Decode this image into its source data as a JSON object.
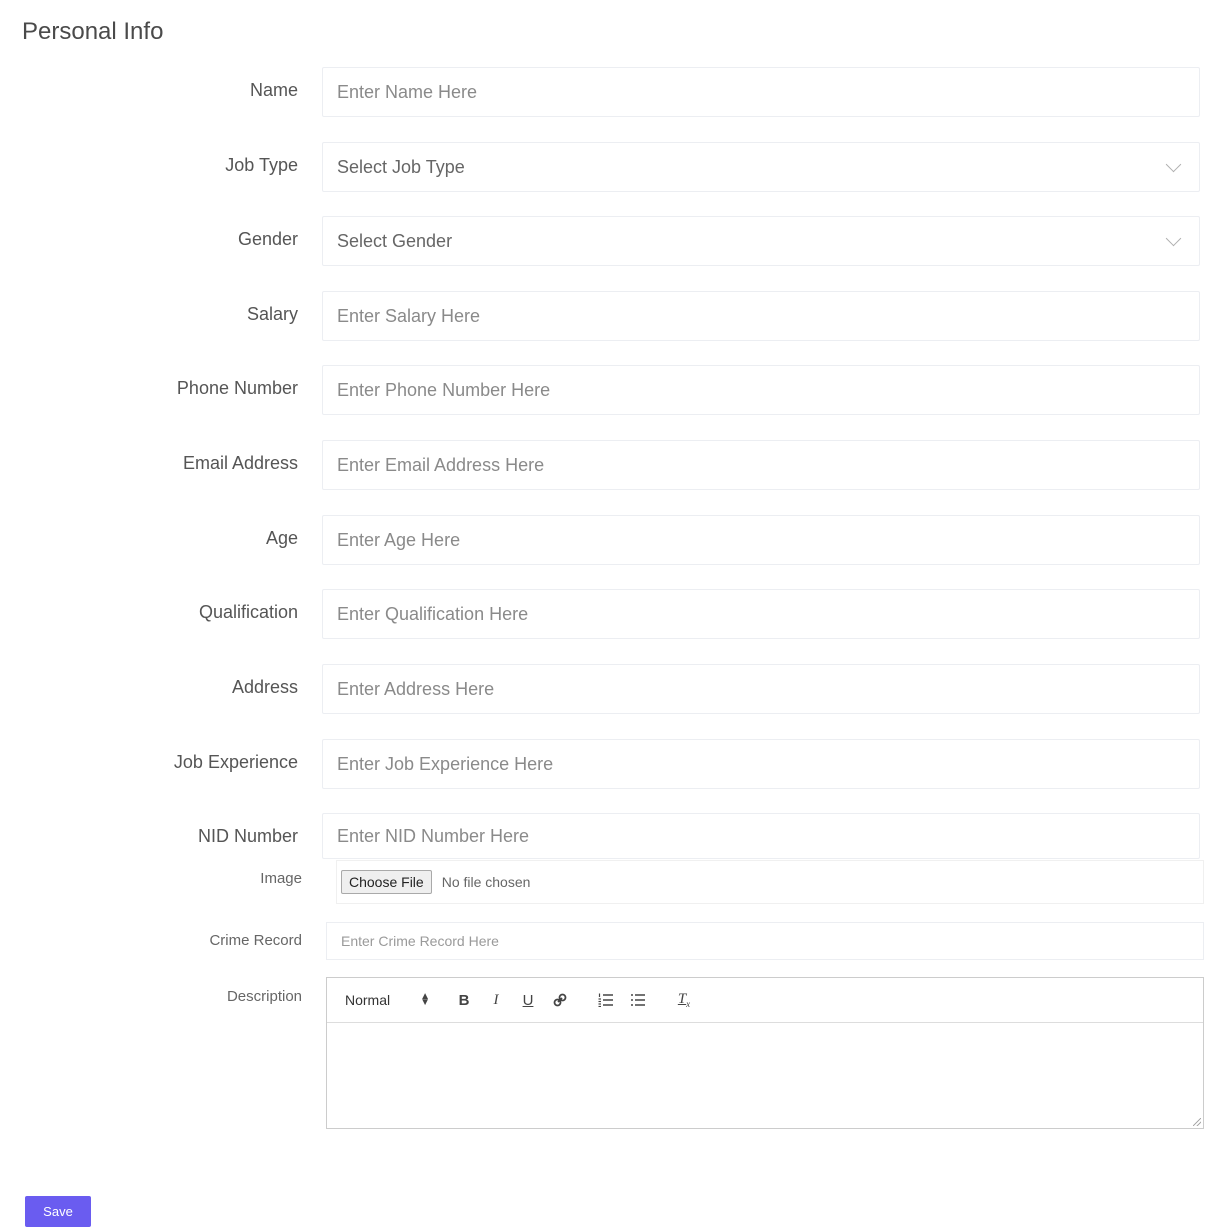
{
  "page": {
    "title": "Personal Info"
  },
  "fields": {
    "name": {
      "label": "Name",
      "placeholder": "Enter Name Here"
    },
    "job_type": {
      "label": "Job Type",
      "value": "Select Job Type"
    },
    "gender": {
      "label": "Gender",
      "value": "Select Gender"
    },
    "salary": {
      "label": "Salary",
      "placeholder": "Enter Salary Here"
    },
    "phone": {
      "label": "Phone Number",
      "placeholder": "Enter Phone Number Here"
    },
    "email": {
      "label": "Email Address",
      "placeholder": "Enter Email Address Here"
    },
    "age": {
      "label": "Age",
      "placeholder": "Enter Age Here"
    },
    "qualification": {
      "label": "Qualification",
      "placeholder": "Enter Qualification Here"
    },
    "address": {
      "label": "Address",
      "placeholder": "Enter Address Here"
    },
    "job_experience": {
      "label": "Job Experience",
      "placeholder": "Enter Job Experience Here"
    },
    "nid": {
      "label": "NID Number",
      "placeholder": "Enter NID Number Here"
    },
    "image": {
      "label": "Image",
      "button": "Choose File",
      "status": "No file chosen"
    },
    "crime_record": {
      "label": "Crime Record",
      "placeholder": "Enter Crime Record Here"
    },
    "description": {
      "label": "Description",
      "toolbar": {
        "format": "Normal",
        "bold": "B",
        "italic": "I",
        "underline": "U",
        "link": "🔗",
        "ordered_list": "☰",
        "bullet_list": "☰",
        "clean": "Tx"
      }
    }
  },
  "actions": {
    "save": "Save"
  },
  "colors": {
    "accent": "#6a5cf0",
    "border": "#eceef2",
    "label": "#555555"
  }
}
